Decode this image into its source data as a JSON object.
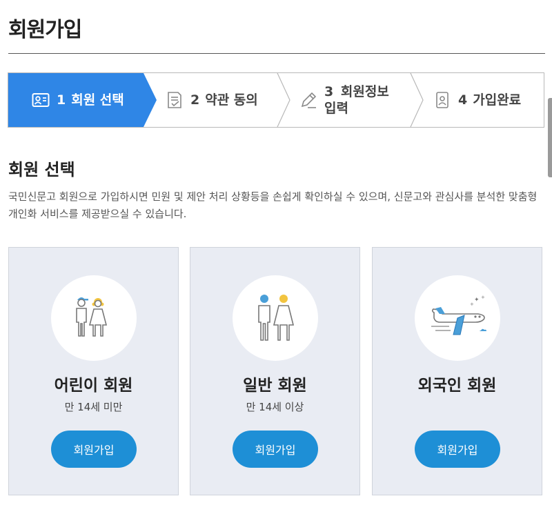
{
  "page": {
    "title": "회원가입"
  },
  "steps": [
    {
      "number": "1",
      "label": "회원 선택",
      "icon": "member-card-icon",
      "active": true
    },
    {
      "number": "2",
      "label": "약관 동의",
      "icon": "document-check-icon",
      "active": false
    },
    {
      "number": "3",
      "label": "회원정보",
      "label2": "입력",
      "icon": "pencil-edit-icon",
      "active": false
    },
    {
      "number": "4",
      "label": "가입완료",
      "icon": "id-badge-icon",
      "active": false
    }
  ],
  "section": {
    "title": "회원 선택",
    "description": "국민신문고 회원으로 가입하시면 민원 및 제안 처리 상황등을 손쉽게 확인하실 수 있으며, 신문고와 관심사를 분석한 맞춤형 개인화 서비스를 제공받으실 수 있습니다."
  },
  "cards": [
    {
      "name": "어린이 회원",
      "sub": "만 14세 미만",
      "button": "회원가입",
      "icon": "children-icon"
    },
    {
      "name": "일반 회원",
      "sub": "만 14세 이상",
      "button": "회원가입",
      "icon": "adults-icon"
    },
    {
      "name": "외국인 회원",
      "sub": "",
      "button": "회원가입",
      "icon": "airplane-icon"
    }
  ],
  "colors": {
    "accent": "#2f86e6",
    "button": "#1e8fd6",
    "card_bg": "#e9ecf3"
  }
}
